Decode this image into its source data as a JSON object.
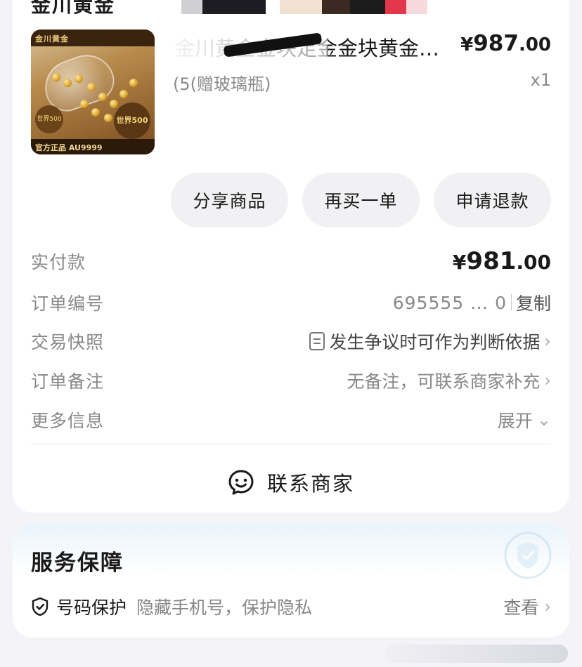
{
  "order": {
    "shop_name": "金川黄金",
    "product": {
      "title": "金川黄金金块足金金块黄金…",
      "spec": "(5(赠玻璃瓶)",
      "price_yen": "¥",
      "price_int": "987",
      "price_dec": ".00",
      "qty": "x1",
      "image_brand": "金川黄金",
      "image_footer": "官方正品 AU9999",
      "image_seal": "世界500强",
      "image_left_seal": "世界500强"
    },
    "actions": [
      "分享商品",
      "再买一单",
      "申请退款"
    ],
    "paid": {
      "label": "实付款",
      "yen": "¥",
      "int": "981",
      "dec": ".00"
    },
    "order_no": {
      "label": "订单编号",
      "value": "695555 … 0",
      "copy": "复制"
    },
    "snapshot": {
      "label": "交易快照",
      "value": "发生争议时可作为判断依据"
    },
    "remark": {
      "label": "订单备注",
      "value": "无备注，可联系商家补充"
    },
    "more": {
      "label": "更多信息",
      "value": "展开"
    },
    "contact": "联系商家"
  },
  "service": {
    "title": "服务保障",
    "name": "号码保护",
    "desc": "隐藏手机号，保护隐私",
    "view": "查看"
  },
  "colors": {
    "background": "#f4f4f8",
    "card": "#ffffff",
    "pill": "#f1f1f4",
    "muted_text": "#888888"
  }
}
